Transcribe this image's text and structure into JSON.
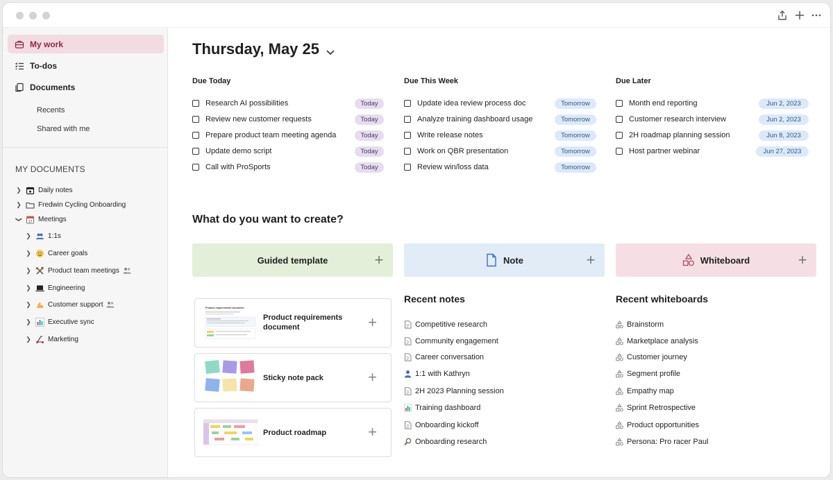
{
  "sidebar": {
    "nav": [
      {
        "label": "My work",
        "icon": "briefcase-icon",
        "active": true
      },
      {
        "label": "To-dos",
        "icon": "checklist-icon"
      },
      {
        "label": "Documents",
        "icon": "documents-icon"
      }
    ],
    "sub_items": [
      "Recents",
      "Shared with me"
    ],
    "section_title": "MY DOCUMENTS",
    "tree": [
      {
        "label": "Daily notes",
        "icon": "calendar-icon"
      },
      {
        "label": "Fredwin Cycling Onboarding",
        "icon": "folder-icon"
      },
      {
        "label": "Meetings",
        "icon": "calendar-spiral-icon",
        "expanded": true
      },
      {
        "label": "1:1s",
        "icon": "people-icon"
      },
      {
        "label": "Career goals",
        "icon": "face-icon"
      },
      {
        "label": "Product team meetings",
        "icon": "tools-icon",
        "shared": true
      },
      {
        "label": "Engineering",
        "icon": "laptop-icon"
      },
      {
        "label": "Customer support",
        "icon": "flexed-arm-icon",
        "shared": true
      },
      {
        "label": "Executive sync",
        "icon": "bar-chart-icon"
      },
      {
        "label": "Marketing",
        "icon": "scooter-icon"
      }
    ]
  },
  "main": {
    "date_title": "Thursday, May 25",
    "columns": [
      {
        "title": "Due Today",
        "tasks": [
          {
            "label": "Research AI possibilities",
            "badge": "Today"
          },
          {
            "label": "Review new customer requests",
            "badge": "Today"
          },
          {
            "label": "Prepare product team meeting agenda",
            "badge": "Today"
          },
          {
            "label": "Update demo script",
            "badge": "Today"
          },
          {
            "label": "Call with ProSports",
            "badge": "Today"
          }
        ]
      },
      {
        "title": "Due This Week",
        "tasks": [
          {
            "label": "Update idea review process doc",
            "badge": "Tomorrow"
          },
          {
            "label": "Analyze training dashboard usage",
            "badge": "Tomorrow"
          },
          {
            "label": "Write release notes",
            "badge": "Tomorrow"
          },
          {
            "label": "Work on QBR presentation",
            "badge": "Tomorrow"
          },
          {
            "label": "Review win/loss data",
            "badge": "Tomorrow"
          }
        ]
      },
      {
        "title": "Due Later",
        "tasks": [
          {
            "label": "Month end reporting",
            "badge": "Jun 2, 2023"
          },
          {
            "label": "Customer research interview",
            "badge": "Jun 2, 2023"
          },
          {
            "label": "2H roadmap planning session",
            "badge": "Jun 8, 2023"
          },
          {
            "label": "Host partner webinar",
            "badge": "Jun 27, 2023"
          }
        ]
      }
    ],
    "create_title": "What do you want to create?",
    "create_cards": [
      {
        "label": "Guided template",
        "color": "#e3efd9"
      },
      {
        "label": "Note",
        "color": "#e1ecf7",
        "icon": "note-icon"
      },
      {
        "label": "Whiteboard",
        "color": "#f5dfe4",
        "icon": "shapes-icon"
      }
    ],
    "templates": [
      {
        "label": "Product requirements document",
        "thumb_caption": "Product requirements document"
      },
      {
        "label": "Sticky note pack"
      },
      {
        "label": "Product roadmap"
      }
    ],
    "recent_notes_title": "Recent notes",
    "recent_notes": [
      {
        "label": "Competitive research",
        "icon": "doc-icon"
      },
      {
        "label": "Community engagement",
        "icon": "doc-icon"
      },
      {
        "label": "Career conversation",
        "icon": "doc-icon"
      },
      {
        "label": "1:1 with Kathryn",
        "icon": "person-icon"
      },
      {
        "label": "2H 2023 Planning session",
        "icon": "doc-icon"
      },
      {
        "label": "Training dashboard",
        "icon": "bar-chart-icon"
      },
      {
        "label": "Onboarding kickoff",
        "icon": "doc-icon"
      },
      {
        "label": "Onboarding research",
        "icon": "magnifier-icon"
      }
    ],
    "recent_whiteboards_title": "Recent whiteboards",
    "recent_whiteboards": [
      {
        "label": "Brainstorm"
      },
      {
        "label": "Marketplace analysis"
      },
      {
        "label": "Customer journey"
      },
      {
        "label": "Segment profile"
      },
      {
        "label": "Empathy map"
      },
      {
        "label": "Sprint Retrospective"
      },
      {
        "label": "Product opportunities"
      },
      {
        "label": "Persona: Pro racer Paul"
      }
    ]
  }
}
